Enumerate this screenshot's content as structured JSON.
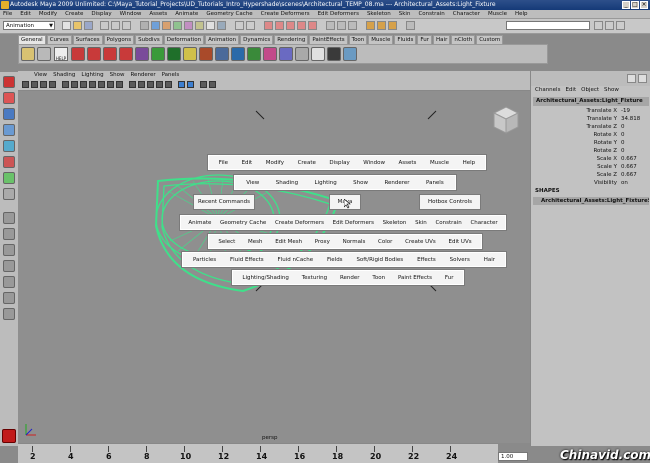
{
  "window": {
    "title": "Autodesk Maya 2009 Unlimited: C:\\Maya_Tutorial_Projects\\UD_Tutorials_Intro_Hypershade\\scenes\\Architectural_TEMP_08.ma  ---  Architectural_Assets:Light_Fixture",
    "min": "_",
    "max": "□",
    "close": "×"
  },
  "menubar": [
    "File",
    "Edit",
    "Modify",
    "Create",
    "Display",
    "Window",
    "Assets",
    "Animate",
    "Geometry Cache",
    "Create Deformers",
    "Edit Deformers",
    "Skeleton",
    "Skin",
    "Constrain",
    "Character",
    "Muscle",
    "Help"
  ],
  "statusline": {
    "module": "Animation"
  },
  "shelf": {
    "tabs": [
      "General",
      "Curves",
      "Surfaces",
      "Polygons",
      "Subdivs",
      "Deformation",
      "Animation",
      "Dynamics",
      "Rendering",
      "PaintEffects",
      "Toon",
      "Muscle",
      "Fluids",
      "Fur",
      "Hair",
      "nCloth",
      "Custom"
    ],
    "help_label": "HELP"
  },
  "panel": {
    "menu": [
      "View",
      "Shading",
      "Lighting",
      "Show",
      "Renderer",
      "Panels"
    ],
    "camera": "persp"
  },
  "hotbox": {
    "row1": [
      "File",
      "Edit",
      "Modify",
      "Create",
      "Display",
      "Window",
      "Assets",
      "Muscle",
      "Help"
    ],
    "row2": [
      "View",
      "Shading",
      "Lighting",
      "Show",
      "Renderer",
      "Panels"
    ],
    "recent": "Recent Commands",
    "center": "Maya",
    "controls": "Hotbox Controls",
    "row3": [
      "Animate",
      "Geometry Cache",
      "Create Deformers",
      "Edit Deformers",
      "Skeleton",
      "Skin",
      "Constrain",
      "Character"
    ],
    "row4": [
      "Select",
      "Mesh",
      "Edit Mesh",
      "Proxy",
      "Normals",
      "Color",
      "Create UVs",
      "Edit UVs"
    ],
    "row5": [
      "Particles",
      "Fluid Effects",
      "Fluid nCache",
      "Fields",
      "Soft/Rigid Bodies",
      "Effects",
      "Solvers",
      "Hair"
    ],
    "row6": [
      "Lighting/Shading",
      "Texturing",
      "Render",
      "Toon",
      "Paint Effects",
      "Fur"
    ]
  },
  "channelbox": {
    "menu": [
      "Channels",
      "Edit",
      "Object",
      "Show"
    ],
    "object": "Architectural_Assets:Light_Fixture",
    "attributes": [
      {
        "name": "Translate X",
        "value": "-19"
      },
      {
        "name": "Translate Y",
        "value": "34.818"
      },
      {
        "name": "Translate Z",
        "value": "0"
      },
      {
        "name": "Rotate X",
        "value": "0"
      },
      {
        "name": "Rotate Y",
        "value": "0"
      },
      {
        "name": "Rotate Z",
        "value": "0"
      },
      {
        "name": "Scale X",
        "value": "0.667"
      },
      {
        "name": "Scale Y",
        "value": "0.667"
      },
      {
        "name": "Scale Z",
        "value": "0.667"
      },
      {
        "name": "Visibility",
        "value": "on"
      }
    ],
    "shapes_header": "SHAPES",
    "shape": "Architectural_Assets:Light_FixtureS"
  },
  "timeslider": {
    "labels": [
      "2",
      "4",
      "6",
      "8",
      "10",
      "12",
      "14",
      "16",
      "18",
      "20",
      "22",
      "24"
    ],
    "range_value": "1.00"
  },
  "watermark": "Chinavid.com"
}
